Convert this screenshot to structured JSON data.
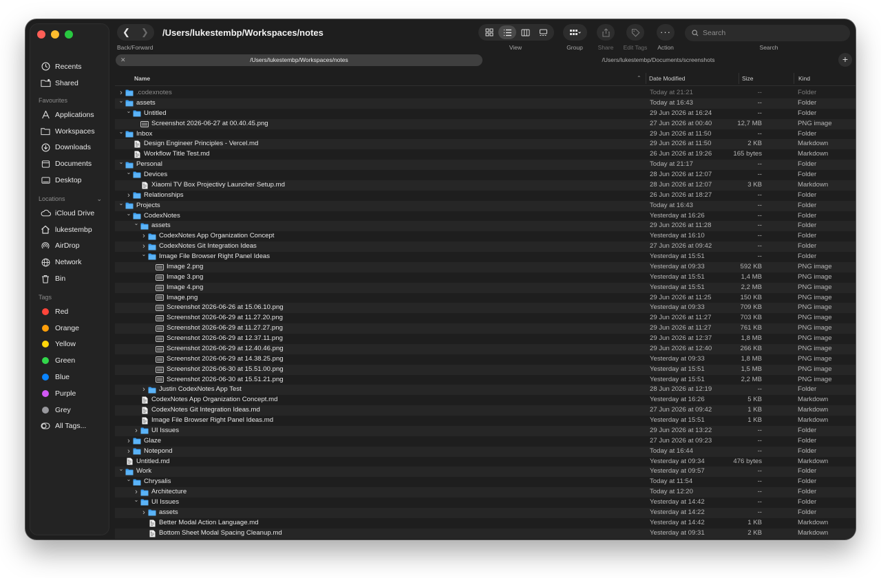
{
  "window": {
    "path_title": "/Users/lukestembp/Workspaces/notes"
  },
  "toolbar": {
    "back_forward_label": "Back/Forward",
    "view_label": "View",
    "group_label": "Group",
    "share_label": "Share",
    "edit_tags_label": "Edit Tags",
    "action_label": "Action",
    "search_label": "Search",
    "search_placeholder": "Search"
  },
  "tabs": [
    {
      "label": "/Users/lukestembp/Workspaces/notes",
      "active": true
    },
    {
      "label": "/Users/lukestembp/Documents/screenshots",
      "active": false
    }
  ],
  "sidebar": {
    "top_items": [
      {
        "label": "Recents",
        "icon": "clock-icon"
      },
      {
        "label": "Shared",
        "icon": "shared-folder-icon"
      }
    ],
    "favourites_heading": "Favourites",
    "favourites": [
      {
        "label": "Applications",
        "icon": "applications-icon"
      },
      {
        "label": "Workspaces",
        "icon": "folder-icon"
      },
      {
        "label": "Downloads",
        "icon": "download-icon"
      },
      {
        "label": "Documents",
        "icon": "document-icon"
      },
      {
        "label": "Desktop",
        "icon": "desktop-icon"
      }
    ],
    "locations_heading": "Locations",
    "locations": [
      {
        "label": "iCloud Drive",
        "icon": "cloud-icon"
      },
      {
        "label": "lukestembp",
        "icon": "home-icon"
      },
      {
        "label": "AirDrop",
        "icon": "airdrop-icon"
      },
      {
        "label": "Network",
        "icon": "globe-icon"
      },
      {
        "label": "Bin",
        "icon": "trash-icon"
      }
    ],
    "tags_heading": "Tags",
    "tags": [
      {
        "label": "Red",
        "color": "#ff453a"
      },
      {
        "label": "Orange",
        "color": "#ff9f0a"
      },
      {
        "label": "Yellow",
        "color": "#ffd60a"
      },
      {
        "label": "Green",
        "color": "#32d74b"
      },
      {
        "label": "Blue",
        "color": "#0a84ff"
      },
      {
        "label": "Purple",
        "color": "#d158f5"
      },
      {
        "label": "Grey",
        "color": "#98989d"
      },
      {
        "label": "All Tags...",
        "color": ""
      }
    ]
  },
  "columns": {
    "name": "Name",
    "date": "Date Modified",
    "size": "Size",
    "kind": "Kind"
  },
  "files": [
    {
      "name": ".codexnotes",
      "depth": 0,
      "type": "folder",
      "chev": "right",
      "date": "Today at 21:21",
      "size": "--",
      "kind": "Folder",
      "dim": true
    },
    {
      "name": "assets",
      "depth": 0,
      "type": "folder",
      "chev": "down",
      "date": "Today at 16:43",
      "size": "--",
      "kind": "Folder"
    },
    {
      "name": "Untitled",
      "depth": 1,
      "type": "folder",
      "chev": "down",
      "date": "29 Jun 2026 at 16:24",
      "size": "--",
      "kind": "Folder"
    },
    {
      "name": "Screenshot 2026-06-27 at 00.40.45.png",
      "depth": 2,
      "type": "image",
      "chev": "",
      "date": "27 Jun 2026 at 00:40",
      "size": "12,7 MB",
      "kind": "PNG image"
    },
    {
      "name": "Inbox",
      "depth": 0,
      "type": "folder",
      "chev": "down",
      "date": "29 Jun 2026 at 11:50",
      "size": "--",
      "kind": "Folder"
    },
    {
      "name": "Design Engineer Principles - Vercel.md",
      "depth": 1,
      "type": "md",
      "chev": "",
      "date": "29 Jun 2026 at 11:50",
      "size": "2 KB",
      "kind": "Markdown"
    },
    {
      "name": "Workflow Title Test.md",
      "depth": 1,
      "type": "md",
      "chev": "",
      "date": "26 Jun 2026 at 19:26",
      "size": "165 bytes",
      "kind": "Markdown"
    },
    {
      "name": "Personal",
      "depth": 0,
      "type": "folder",
      "chev": "down",
      "date": "Today at 21:17",
      "size": "--",
      "kind": "Folder"
    },
    {
      "name": "Devices",
      "depth": 1,
      "type": "folder",
      "chev": "down",
      "date": "28 Jun 2026 at 12:07",
      "size": "--",
      "kind": "Folder"
    },
    {
      "name": "Xiaomi TV Box Projectivy Launcher Setup.md",
      "depth": 2,
      "type": "md",
      "chev": "",
      "date": "28 Jun 2026 at 12:07",
      "size": "3 KB",
      "kind": "Markdown"
    },
    {
      "name": "Relationships",
      "depth": 1,
      "type": "folder",
      "chev": "right",
      "date": "26 Jun 2026 at 18:27",
      "size": "--",
      "kind": "Folder"
    },
    {
      "name": "Projects",
      "depth": 0,
      "type": "folder",
      "chev": "down",
      "date": "Today at 16:43",
      "size": "--",
      "kind": "Folder"
    },
    {
      "name": "CodexNotes",
      "depth": 1,
      "type": "folder",
      "chev": "down",
      "date": "Yesterday at 16:26",
      "size": "--",
      "kind": "Folder"
    },
    {
      "name": "assets",
      "depth": 2,
      "type": "folder",
      "chev": "down",
      "date": "29 Jun 2026 at 11:28",
      "size": "--",
      "kind": "Folder"
    },
    {
      "name": "CodexNotes App Organization Concept",
      "depth": 3,
      "type": "folder",
      "chev": "right",
      "date": "Yesterday at 16:10",
      "size": "--",
      "kind": "Folder"
    },
    {
      "name": "CodexNotes Git Integration Ideas",
      "depth": 3,
      "type": "folder",
      "chev": "right",
      "date": "27 Jun 2026 at 09:42",
      "size": "--",
      "kind": "Folder"
    },
    {
      "name": "Image File Browser Right Panel Ideas",
      "depth": 3,
      "type": "folder",
      "chev": "down",
      "date": "Yesterday at 15:51",
      "size": "--",
      "kind": "Folder"
    },
    {
      "name": "Image 2.png",
      "depth": 4,
      "type": "image",
      "chev": "",
      "date": "Yesterday at 09:33",
      "size": "592 KB",
      "kind": "PNG image"
    },
    {
      "name": "Image 3.png",
      "depth": 4,
      "type": "image",
      "chev": "",
      "date": "Yesterday at 15:51",
      "size": "1,4 MB",
      "kind": "PNG image"
    },
    {
      "name": "Image 4.png",
      "depth": 4,
      "type": "image",
      "chev": "",
      "date": "Yesterday at 15:51",
      "size": "2,2 MB",
      "kind": "PNG image"
    },
    {
      "name": "Image.png",
      "depth": 4,
      "type": "image",
      "chev": "",
      "date": "29 Jun 2026 at 11:25",
      "size": "150 KB",
      "kind": "PNG image"
    },
    {
      "name": "Screenshot 2026-06-26 at 15.06.10.png",
      "depth": 4,
      "type": "image",
      "chev": "",
      "date": "Yesterday at 09:33",
      "size": "709 KB",
      "kind": "PNG image"
    },
    {
      "name": "Screenshot 2026-06-29 at 11.27.20.png",
      "depth": 4,
      "type": "image",
      "chev": "",
      "date": "29 Jun 2026 at 11:27",
      "size": "703 KB",
      "kind": "PNG image"
    },
    {
      "name": "Screenshot 2026-06-29 at 11.27.27.png",
      "depth": 4,
      "type": "image",
      "chev": "",
      "date": "29 Jun 2026 at 11:27",
      "size": "761 KB",
      "kind": "PNG image"
    },
    {
      "name": "Screenshot 2026-06-29 at 12.37.11.png",
      "depth": 4,
      "type": "image",
      "chev": "",
      "date": "29 Jun 2026 at 12:37",
      "size": "1,8 MB",
      "kind": "PNG image"
    },
    {
      "name": "Screenshot 2026-06-29 at 12.40.46.png",
      "depth": 4,
      "type": "image",
      "chev": "",
      "date": "29 Jun 2026 at 12:40",
      "size": "266 KB",
      "kind": "PNG image"
    },
    {
      "name": "Screenshot 2026-06-29 at 14.38.25.png",
      "depth": 4,
      "type": "image",
      "chev": "",
      "date": "Yesterday at 09:33",
      "size": "1,8 MB",
      "kind": "PNG image"
    },
    {
      "name": "Screenshot 2026-06-30 at 15.51.00.png",
      "depth": 4,
      "type": "image",
      "chev": "",
      "date": "Yesterday at 15:51",
      "size": "1,5 MB",
      "kind": "PNG image"
    },
    {
      "name": "Screenshot 2026-06-30 at 15.51.21.png",
      "depth": 4,
      "type": "image",
      "chev": "",
      "date": "Yesterday at 15:51",
      "size": "2,2 MB",
      "kind": "PNG image"
    },
    {
      "name": "Justin CodexNotes App Test",
      "depth": 3,
      "type": "folder",
      "chev": "right",
      "date": "28 Jun 2026 at 12:19",
      "size": "--",
      "kind": "Folder"
    },
    {
      "name": "CodexNotes App Organization Concept.md",
      "depth": 2,
      "type": "md",
      "chev": "",
      "date": "Yesterday at 16:26",
      "size": "5 KB",
      "kind": "Markdown"
    },
    {
      "name": "CodexNotes Git Integration Ideas.md",
      "depth": 2,
      "type": "md",
      "chev": "",
      "date": "27 Jun 2026 at 09:42",
      "size": "1 KB",
      "kind": "Markdown"
    },
    {
      "name": "Image File Browser Right Panel Ideas.md",
      "depth": 2,
      "type": "md",
      "chev": "",
      "date": "Yesterday at 15:51",
      "size": "1 KB",
      "kind": "Markdown"
    },
    {
      "name": "UI Issues",
      "depth": 2,
      "type": "folder",
      "chev": "right",
      "date": "29 Jun 2026 at 13:22",
      "size": "--",
      "kind": "Folder"
    },
    {
      "name": "Glaze",
      "depth": 1,
      "type": "folder",
      "chev": "right",
      "date": "27 Jun 2026 at 09:23",
      "size": "--",
      "kind": "Folder"
    },
    {
      "name": "Notepond",
      "depth": 1,
      "type": "folder",
      "chev": "right",
      "date": "Today at 16:44",
      "size": "--",
      "kind": "Folder"
    },
    {
      "name": "Untitled.md",
      "depth": 0,
      "type": "md",
      "chev": "",
      "date": "Yesterday at 09:34",
      "size": "476 bytes",
      "kind": "Markdown"
    },
    {
      "name": "Work",
      "depth": 0,
      "type": "folder",
      "chev": "down",
      "date": "Yesterday at 09:57",
      "size": "--",
      "kind": "Folder"
    },
    {
      "name": "Chrysalis",
      "depth": 1,
      "type": "folder",
      "chev": "down",
      "date": "Today at 11:54",
      "size": "--",
      "kind": "Folder"
    },
    {
      "name": "Architecture",
      "depth": 2,
      "type": "folder",
      "chev": "right",
      "date": "Today at 12:20",
      "size": "--",
      "kind": "Folder"
    },
    {
      "name": "UI Issues",
      "depth": 2,
      "type": "folder",
      "chev": "down",
      "date": "Yesterday at 14:42",
      "size": "--",
      "kind": "Folder"
    },
    {
      "name": "assets",
      "depth": 3,
      "type": "folder",
      "chev": "right",
      "date": "Yesterday at 14:22",
      "size": "--",
      "kind": "Folder"
    },
    {
      "name": "Better Modal Action Language.md",
      "depth": 3,
      "type": "md",
      "chev": "",
      "date": "Yesterday at 14:42",
      "size": "1 KB",
      "kind": "Markdown"
    },
    {
      "name": "Bottom Sheet Modal Spacing Cleanup.md",
      "depth": 3,
      "type": "md",
      "chev": "",
      "date": "Yesterday at 09:31",
      "size": "2 KB",
      "kind": "Markdown"
    }
  ]
}
